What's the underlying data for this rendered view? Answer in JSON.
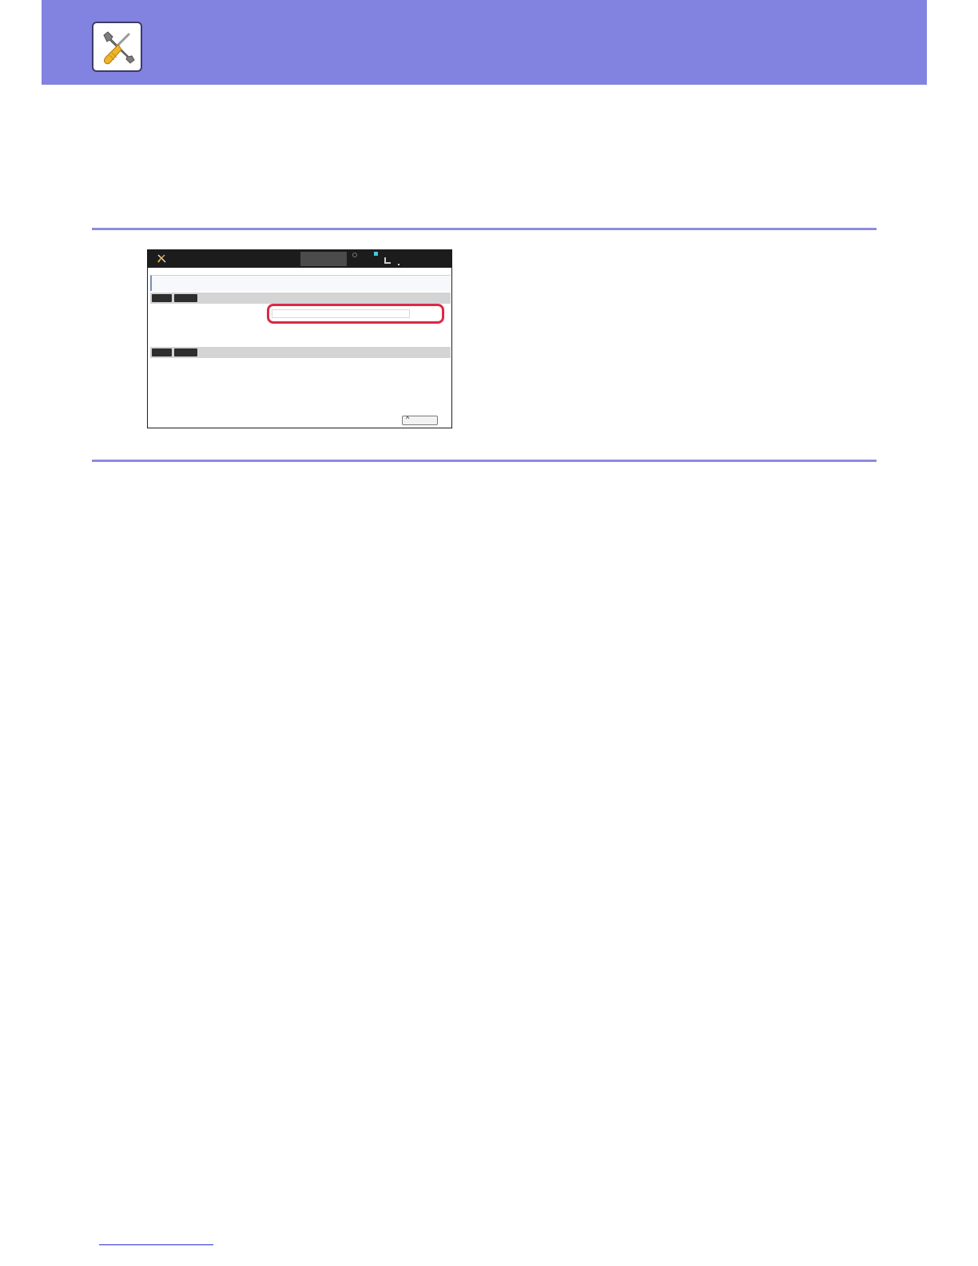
{
  "header": {
    "icon": "wrench-screwdriver-icon",
    "band_color": "#8282e1"
  },
  "device_screen": {
    "title_icon": "wrench-screwdriver-icon",
    "highlight_color": "#dc2846",
    "up_button_glyph": "^"
  },
  "footer": {
    "link_color": "#2b2bd6"
  }
}
